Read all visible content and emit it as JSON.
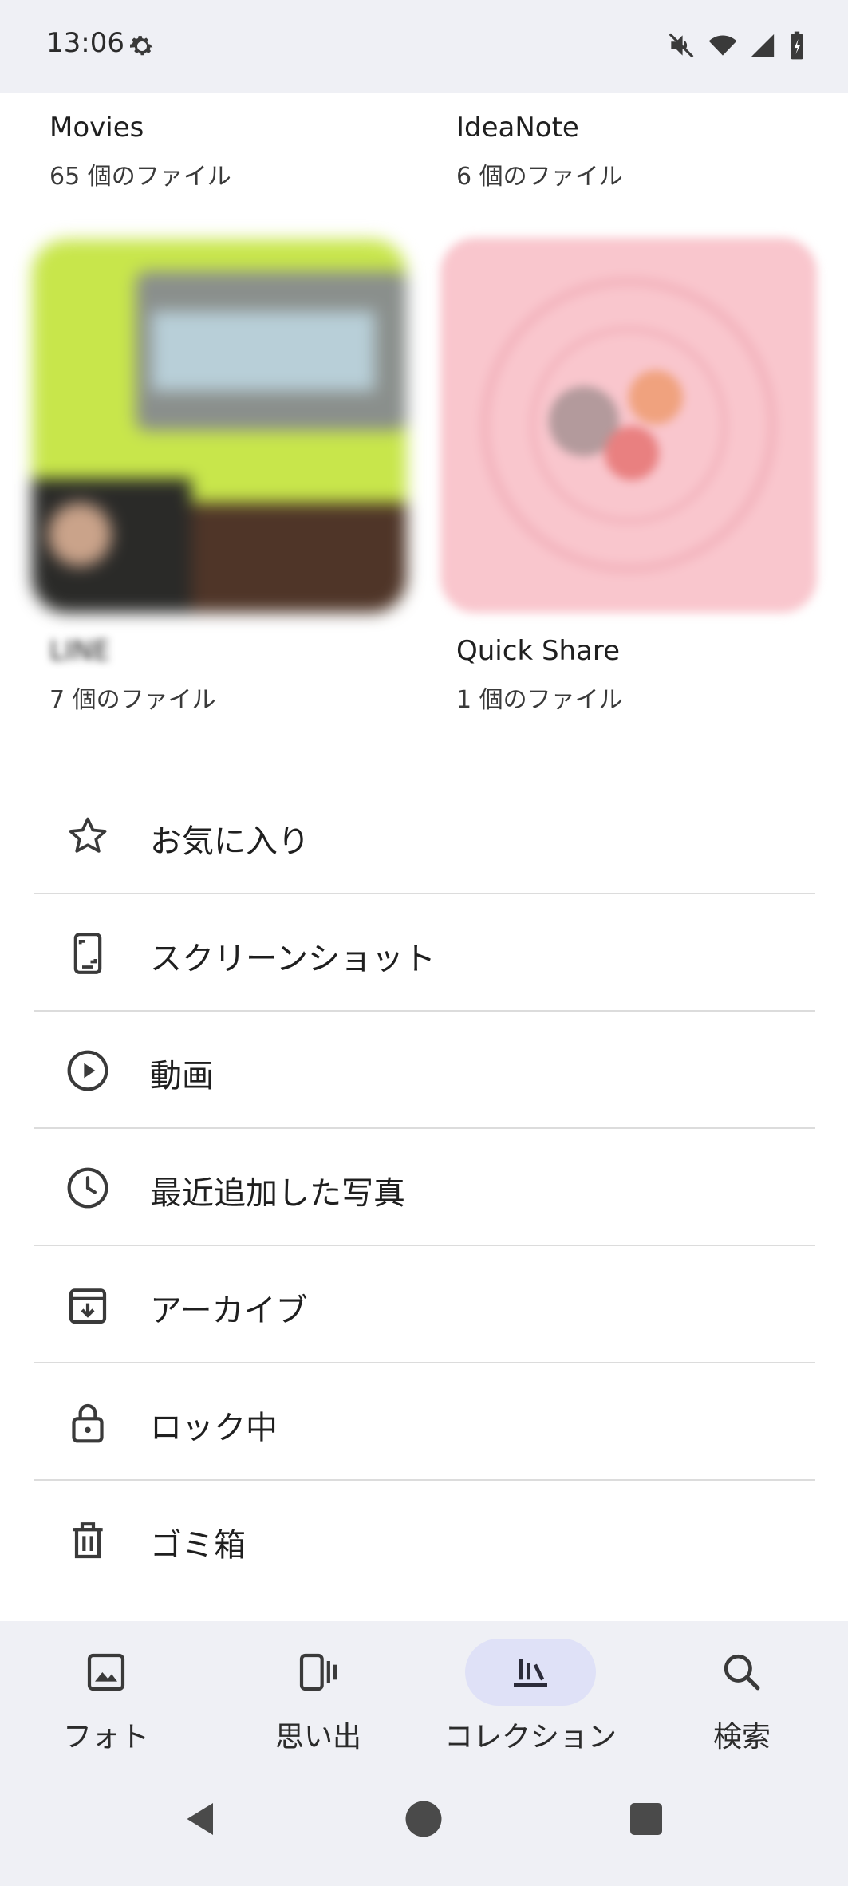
{
  "status_bar": {
    "time": "13:06",
    "icons": [
      "settings-gear-icon",
      "mute-icon",
      "wifi-icon",
      "signal-icon",
      "battery-charging-icon"
    ]
  },
  "albums": [
    {
      "title": "Movies",
      "count": "65 個のファイル"
    },
    {
      "title": "IdeaNote",
      "count": "6 個のファイル"
    },
    {
      "title": "LINE",
      "count": "7 個のファイル"
    },
    {
      "title": "Quick Share",
      "count": "1 個のファイル"
    }
  ],
  "utilities": [
    {
      "label": "お気に入り",
      "icon": "star-icon"
    },
    {
      "label": "スクリーンショット",
      "icon": "screenshot-icon"
    },
    {
      "label": "動画",
      "icon": "play-circle-icon"
    },
    {
      "label": "最近追加した写真",
      "icon": "clock-icon"
    },
    {
      "label": "アーカイブ",
      "icon": "archive-icon"
    },
    {
      "label": "ロック中",
      "icon": "lock-icon"
    },
    {
      "label": "ゴミ箱",
      "icon": "trash-icon"
    }
  ],
  "bottom_nav": [
    {
      "label": "フォト",
      "icon": "photo-icon",
      "active": false
    },
    {
      "label": "思い出",
      "icon": "memories-icon",
      "active": false
    },
    {
      "label": "コレクション",
      "icon": "collections-icon",
      "active": true
    },
    {
      "label": "検索",
      "icon": "search-icon",
      "active": false
    }
  ],
  "colors": {
    "chrome_background": "#eff0f5",
    "active_pill": "#dfe1f7",
    "quick_share_thumb": "#f9c6cd",
    "line_thumb": "#c8e64b"
  }
}
